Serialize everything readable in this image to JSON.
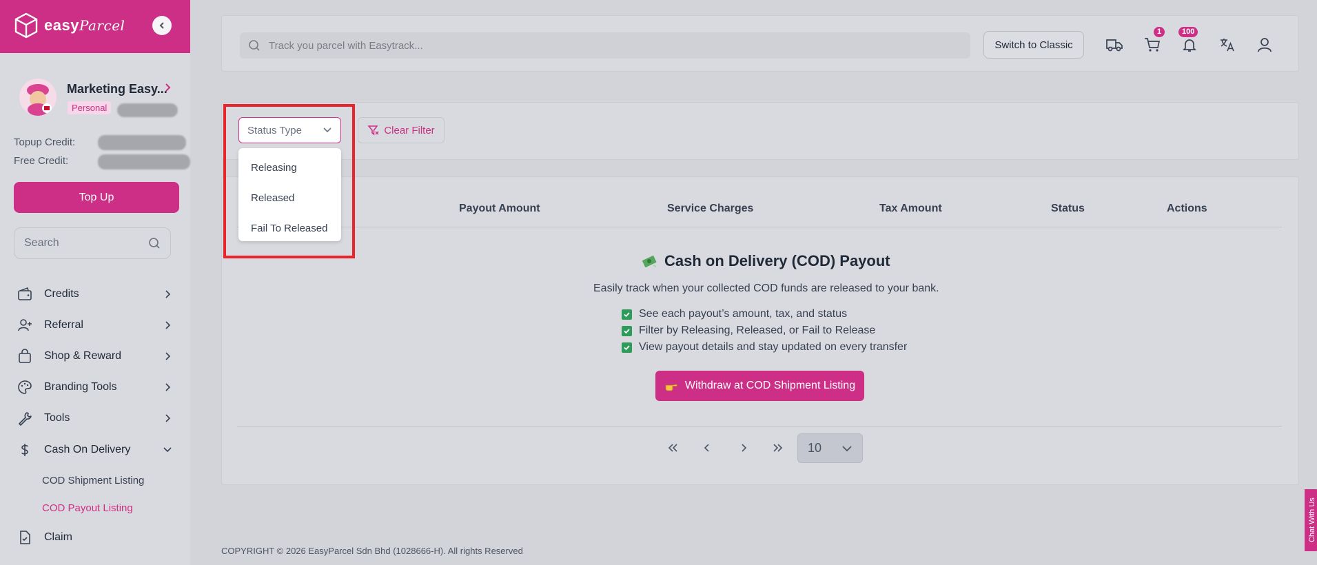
{
  "sidebar": {
    "logo_text": "easy",
    "logo_script": "Parcel",
    "profile": {
      "name": "Marketing Easy...",
      "badge": "Personal"
    },
    "credits": {
      "topup_label": "Topup Credit:",
      "free_label": "Free Credit:"
    },
    "topup_button": "Top Up",
    "search_placeholder": "Search",
    "items": [
      {
        "label": "Credits",
        "icon": "wallet-icon"
      },
      {
        "label": "Referral",
        "icon": "user-plus-icon"
      },
      {
        "label": "Shop & Reward",
        "icon": "shopping-bag-icon"
      },
      {
        "label": "Branding Tools",
        "icon": "palette-icon"
      },
      {
        "label": "Tools",
        "icon": "wrench-icon"
      },
      {
        "label": "Cash On Delivery",
        "icon": "dollar-icon"
      },
      {
        "label": "Claim",
        "icon": "claim-doc-icon"
      }
    ],
    "sub_items": [
      "COD Shipment Listing",
      "COD Payout Listing"
    ]
  },
  "topbar": {
    "track_placeholder": "Track you parcel with Easytrack...",
    "switch_classic": "Switch to Classic",
    "cart_badge": "1",
    "notif_badge": "100"
  },
  "filters": {
    "status_placeholder": "Status Type",
    "status_options": [
      "Releasing",
      "Released",
      "Fail To Released"
    ],
    "clear_filter": "Clear Filter"
  },
  "table": {
    "columns": [
      "Payout Amount",
      "Service Charges",
      "Tax Amount",
      "Status",
      "Actions"
    ]
  },
  "empty_state": {
    "title": "Cash on Delivery (COD) Payout",
    "description": "Easily track when your collected COD funds are released to your bank.",
    "features": [
      "See each payout’s amount, tax, and status",
      "Filter by Releasing, Released, or Fail to Release",
      "View payout details and stay updated on every transfer"
    ],
    "withdraw_button": "Withdraw at COD Shipment Listing"
  },
  "pagination": {
    "page_size": "10"
  },
  "footer": "COPYRIGHT © 2026 EasyParcel Sdn Bhd (1028666-H). All rights Reserved",
  "chat_tab": "Chat With Us",
  "colors": {
    "brand": "#cc2f85",
    "highlight": "#e8252a",
    "check": "#2e9b5a"
  }
}
